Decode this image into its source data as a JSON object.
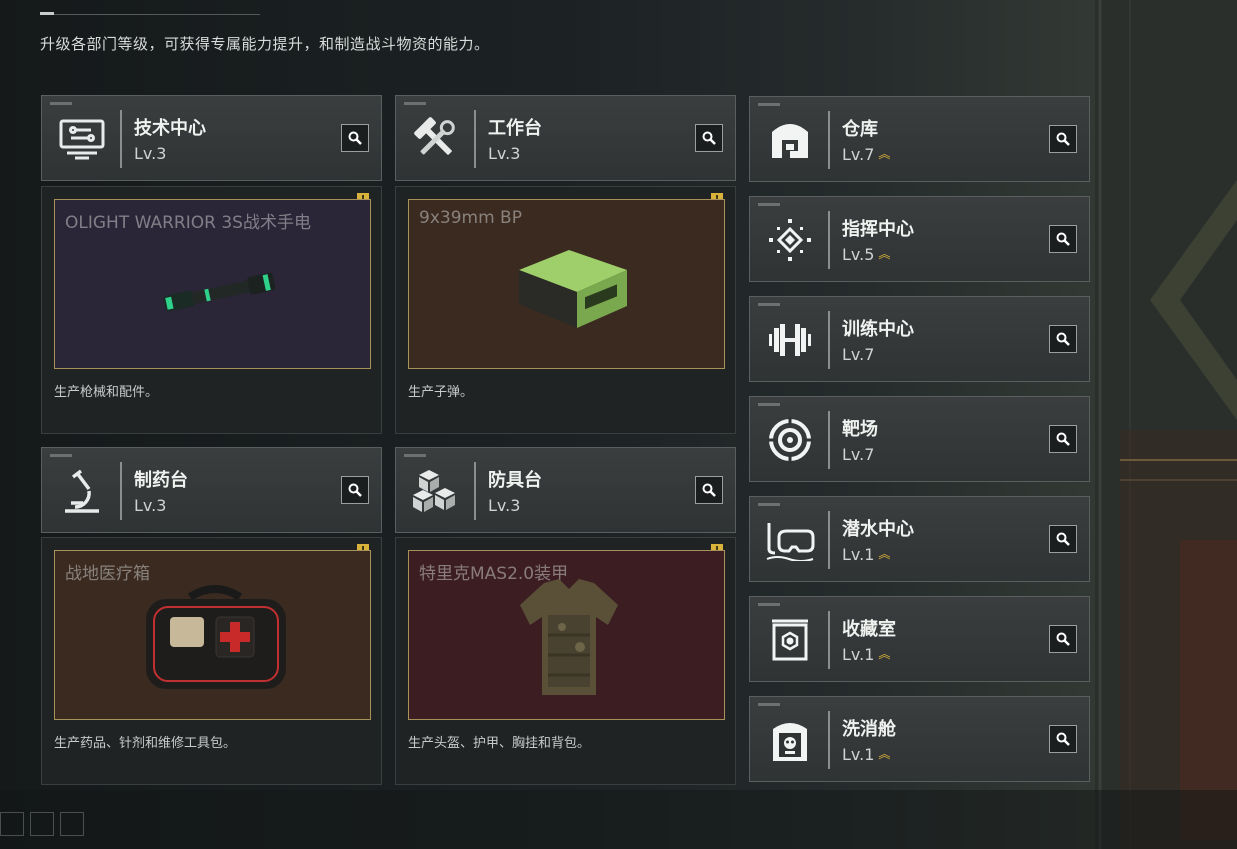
{
  "subtitle": "升级各部门等级，可获得专属能力提升，和制造战斗物资的能力。",
  "main_cards": [
    {
      "name": "技术中心",
      "level": "Lv.3",
      "icon": "computer-icon",
      "item_name": "OLIGHT WARRIOR 3S战术手电",
      "description": "生产枪械和配件。",
      "badge": "!",
      "frame_color": "#2b2538"
    },
    {
      "name": "工作台",
      "level": "Lv.3",
      "icon": "hammer-wrench-icon",
      "item_name": "9x39mm BP",
      "description": "生产子弹。",
      "badge": "!",
      "frame_color": "#3a2a20"
    },
    {
      "name": "制药台",
      "level": "Lv.3",
      "icon": "microscope-icon",
      "item_name": "战地医疗箱",
      "description": "生产药品、针剂和维修工具包。",
      "badge": "!",
      "frame_color": "#3a2a20"
    },
    {
      "name": "防具台",
      "level": "Lv.3",
      "icon": "cubes-icon",
      "item_name": "特里克MAS2.0装甲",
      "description": "生产头盔、护甲、胸挂和背包。",
      "badge": "!",
      "frame_color": "#3c1e22"
    }
  ],
  "side_cards": [
    {
      "name": "仓库",
      "level": "Lv.7",
      "icon": "warehouse-icon",
      "upgrade": true
    },
    {
      "name": "指挥中心",
      "level": "Lv.5",
      "icon": "command-diamond-icon",
      "upgrade": true
    },
    {
      "name": "训练中心",
      "level": "Lv.7",
      "icon": "dumbbell-icon",
      "upgrade": false
    },
    {
      "name": "靶场",
      "level": "Lv.7",
      "icon": "target-icon",
      "upgrade": false
    },
    {
      "name": "潜水中心",
      "level": "Lv.1",
      "icon": "diving-mask-icon",
      "upgrade": true
    },
    {
      "name": "收藏室",
      "level": "Lv.1",
      "icon": "display-case-icon",
      "upgrade": true
    },
    {
      "name": "洗消舱",
      "level": "Lv.1",
      "icon": "decon-chamber-icon",
      "upgrade": true
    }
  ],
  "colors": {
    "accent": "#e0b43a",
    "frame_border": "#a8925a",
    "badge": "#d8b23a"
  }
}
